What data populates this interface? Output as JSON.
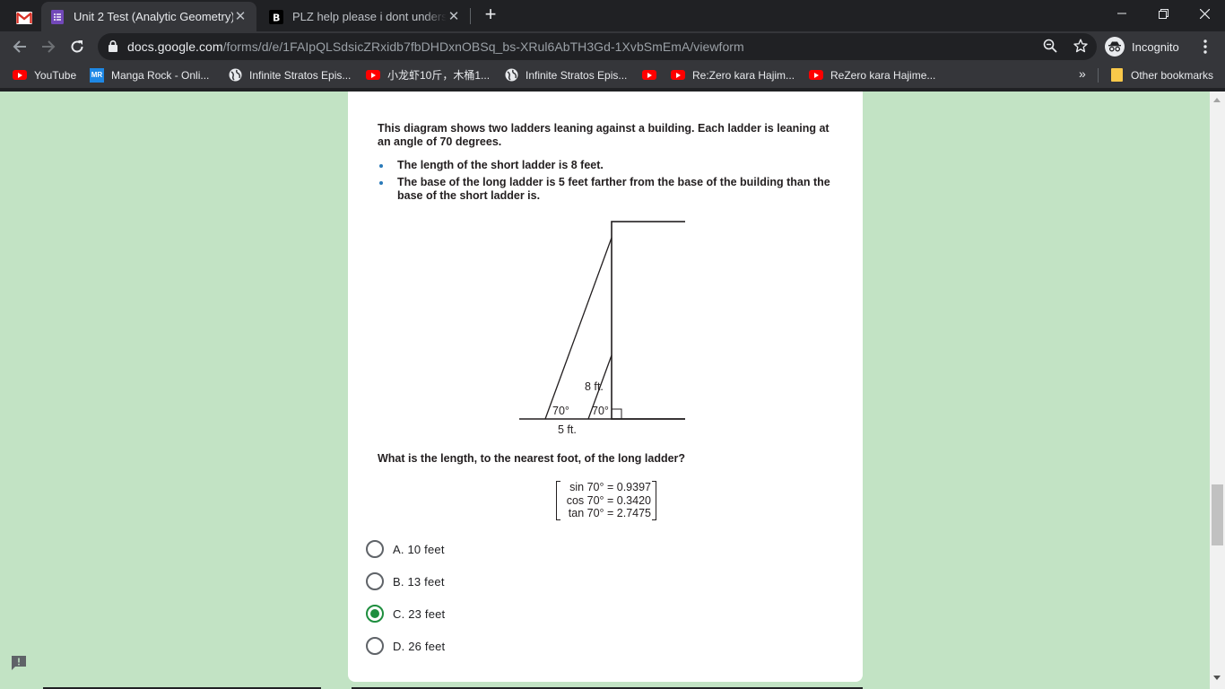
{
  "browser": {
    "tabs": [
      {
        "title": "Unit 2 Test (Analytic Geometry)",
        "active": true,
        "favicon": "google-forms-icon"
      },
      {
        "title": "PLZ help please i dont understand",
        "active": false,
        "favicon": "brainly-icon"
      }
    ],
    "url_host": "docs.google.com",
    "url_path": "/forms/d/e/1FAIpQLSdsicZRxidb7fbDHDxnOBSq_bs-XRul6AbTH3Gd-1XvbSmEmA/viewform",
    "profile_label": "Incognito",
    "bookmarks": [
      {
        "label": "YouTube",
        "icon": "youtube-icon"
      },
      {
        "label": "Manga Rock - Onli...",
        "icon": "manga-rock-icon"
      },
      {
        "label": "Infinite Stratos Epis...",
        "icon": "globe-icon"
      },
      {
        "label": "小龙虾10斤，木桶1...",
        "icon": "youtube-icon"
      },
      {
        "label": "Infinite Stratos Epis...",
        "icon": "globe-icon"
      },
      {
        "label": "",
        "icon": "youtube-icon"
      },
      {
        "label": "Re:Zero kara Hajim...",
        "icon": "youtube-icon"
      },
      {
        "label": "ReZero kara Hajime...",
        "icon": "youtube-icon"
      }
    ],
    "other_bookmarks": "Other bookmarks",
    "overflow_glyph": "»"
  },
  "question": {
    "intro": "This diagram shows two ladders leaning against a building. Each ladder is leaning at an angle of 70 degrees.",
    "bullets": [
      "The length of the short ladder is 8 feet.",
      "The base of the long ladder is 5 feet farther from the base of the building than the base of the short ladder is."
    ],
    "diagram_labels": {
      "short_length": "8 ft.",
      "angle_long": "70°",
      "angle_short": "70°",
      "base_gap": "5 ft."
    },
    "ask": "What is the length, to the nearest foot, of the long ladder?",
    "trig": [
      "sin 70° = 0.9397",
      "cos 70° = 0.3420",
      "tan 70° = 2.7475"
    ]
  },
  "options": [
    {
      "label": "A. 10 feet",
      "selected": false
    },
    {
      "label": "B. 13 feet",
      "selected": false
    },
    {
      "label": "C. 23 feet",
      "selected": true
    },
    {
      "label": "D. 26 feet",
      "selected": false
    }
  ],
  "colors": {
    "page_background": "#c2e3c4",
    "selected_radio": "#1e8e3e",
    "chrome_dark": "#202124"
  }
}
